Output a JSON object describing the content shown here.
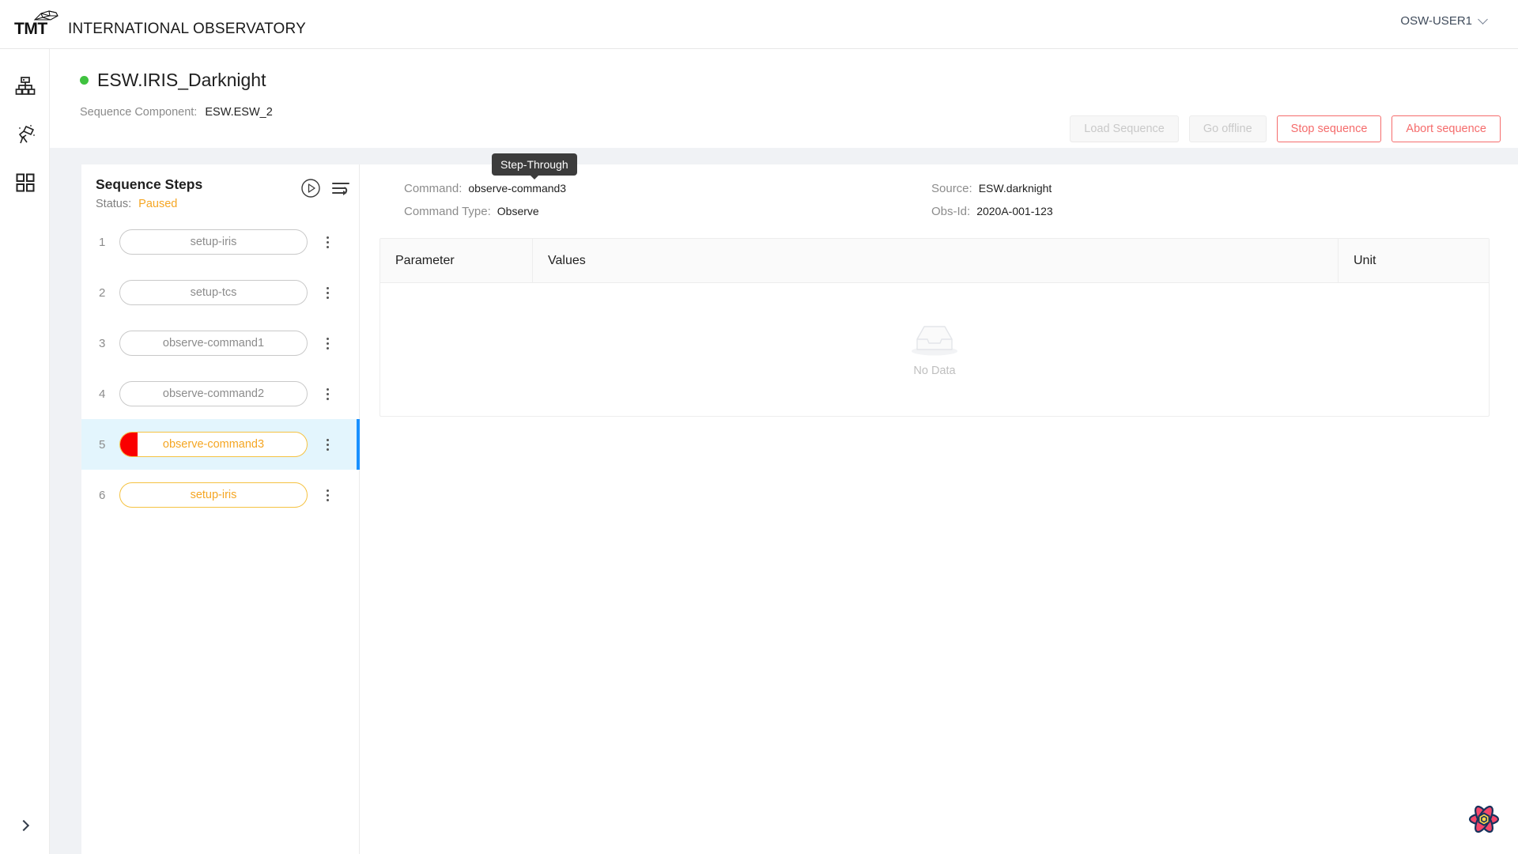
{
  "topbar": {
    "brand_abbr": "TMT",
    "brand_name": "INTERNATIONAL OBSERVATORY",
    "logo_icon": "telescope-dome-icon",
    "user": "OSW-USER1",
    "user_chevron_icon": "chevron-down-icon"
  },
  "rail": {
    "items": [
      {
        "icon": "hierarchy-icon",
        "name": "sidebar-item-hierarchy"
      },
      {
        "icon": "telescope-icon",
        "name": "sidebar-item-observe"
      },
      {
        "icon": "grid-apps-icon",
        "name": "sidebar-item-apps"
      }
    ],
    "expand_icon": "chevron-right-icon"
  },
  "header": {
    "status_dot_color": "#3fc23f",
    "title": "ESW.IRIS_Darknight",
    "component_label": "Sequence Component:",
    "component_value": "ESW.ESW_2",
    "buttons": [
      {
        "label": "Load Sequence",
        "name": "load-sequence-button",
        "style": "disabled"
      },
      {
        "label": "Go offline",
        "name": "go-offline-button",
        "style": "disabled"
      },
      {
        "label": "Stop sequence",
        "name": "stop-sequence-button",
        "style": "danger"
      },
      {
        "label": "Abort sequence",
        "name": "abort-sequence-button",
        "style": "danger"
      }
    ]
  },
  "steps_panel": {
    "title": "Sequence Steps",
    "status_label": "Status:",
    "status_value": "Paused",
    "status_color": "#f5a623",
    "play_icon": "play-circle-icon",
    "step_through_icon": "step-through-icon",
    "tooltip": "Step-Through",
    "steps": [
      {
        "num": "1",
        "label": "setup-iris",
        "state": "done"
      },
      {
        "num": "2",
        "label": "setup-tcs",
        "state": "done"
      },
      {
        "num": "3",
        "label": "observe-command1",
        "state": "done"
      },
      {
        "num": "4",
        "label": "observe-command2",
        "state": "done"
      },
      {
        "num": "5",
        "label": "observe-command3",
        "state": "running"
      },
      {
        "num": "6",
        "label": "setup-iris",
        "state": "pending"
      }
    ]
  },
  "detail": {
    "command_label": "Command:",
    "command_value": "observe-command3",
    "command_type_label": "Command Type:",
    "command_type_value": "Observe",
    "source_label": "Source:",
    "source_value": "ESW.darknight",
    "obsid_label": "Obs-Id:",
    "obsid_value": "2020A-001-123",
    "table": {
      "columns": [
        "Parameter",
        "Values",
        "Unit"
      ],
      "rows": [],
      "empty_text": "No Data",
      "empty_icon": "empty-box-icon"
    }
  },
  "devtools": {
    "icon": "react-query-logo"
  }
}
